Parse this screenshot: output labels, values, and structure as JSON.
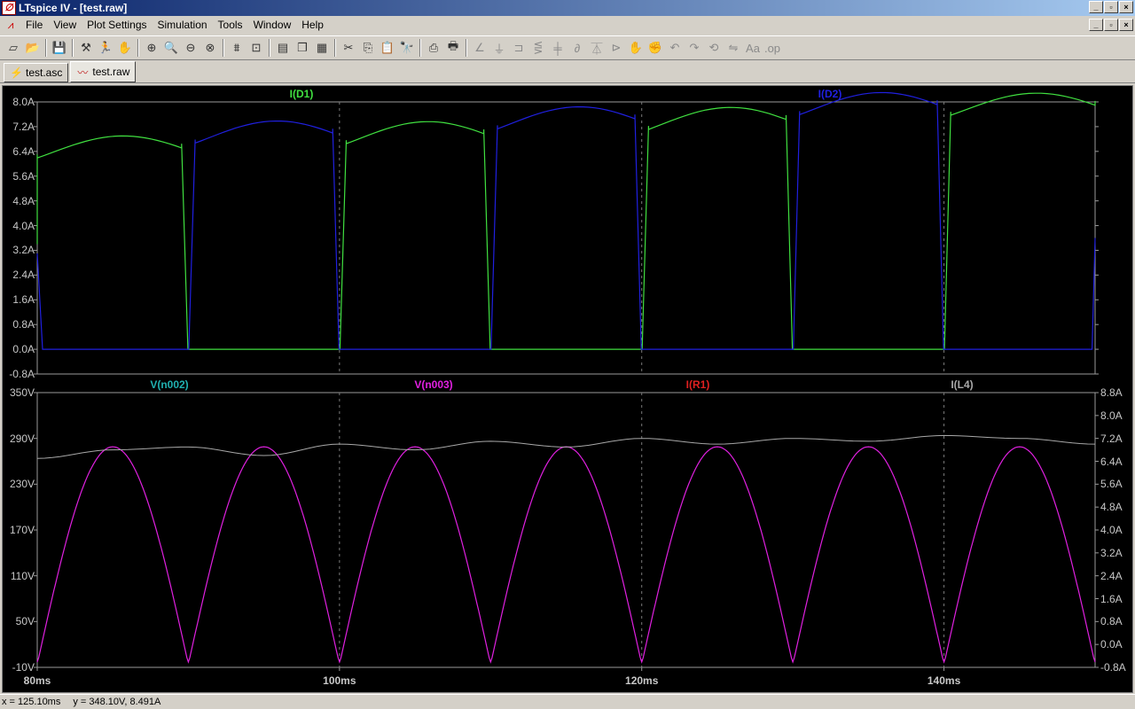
{
  "window": {
    "title": "LTspice IV - [test.raw]",
    "app_icon": "ltspice-app-icon",
    "controls": [
      "_",
      "▫",
      "x"
    ]
  },
  "menubar": {
    "icon": "waveform-doc-icon",
    "items": [
      "File",
      "View",
      "Plot Settings",
      "Simulation",
      "Tools",
      "Window",
      "Help"
    ]
  },
  "toolbar": {
    "buttons": [
      {
        "name": "new-schematic-icon",
        "glyph": "▱"
      },
      {
        "name": "open-icon",
        "glyph": "📂"
      },
      {
        "sep": true
      },
      {
        "name": "save-icon",
        "glyph": "💾"
      },
      {
        "sep": true
      },
      {
        "name": "control-panel-icon",
        "glyph": "⚒"
      },
      {
        "name": "run-icon",
        "glyph": "🏃"
      },
      {
        "name": "pan-icon",
        "glyph": "✋"
      },
      {
        "sep": true
      },
      {
        "name": "zoom-area-icon",
        "glyph": "⊕"
      },
      {
        "name": "zoom-in-icon",
        "glyph": "🔍"
      },
      {
        "name": "zoom-out-icon",
        "glyph": "⊖"
      },
      {
        "name": "zoom-cancel-icon",
        "glyph": "⊗"
      },
      {
        "sep": true
      },
      {
        "name": "autorange-icon",
        "glyph": "⩩"
      },
      {
        "name": "fit-icon",
        "glyph": "⊡"
      },
      {
        "sep": true
      },
      {
        "name": "tile-horizontal-icon",
        "glyph": "▤"
      },
      {
        "name": "cascade-icon",
        "glyph": "❐"
      },
      {
        "name": "tile-vertical-icon",
        "glyph": "▦"
      },
      {
        "sep": true
      },
      {
        "name": "cut-icon",
        "glyph": "✂"
      },
      {
        "name": "copy-icon",
        "glyph": "⎘"
      },
      {
        "name": "paste-icon",
        "glyph": "📋"
      },
      {
        "name": "find-icon",
        "glyph": "🔭"
      },
      {
        "sep": true
      },
      {
        "name": "print-preview-icon",
        "glyph": "⎙"
      },
      {
        "name": "print-icon",
        "glyph": "🖶"
      },
      {
        "sep": true
      },
      {
        "name": "wire-icon",
        "glyph": "∠",
        "dim": true
      },
      {
        "name": "ground-icon",
        "glyph": "⏚",
        "dim": true
      },
      {
        "name": "label-net-icon",
        "glyph": "⊐",
        "dim": true
      },
      {
        "name": "resistor-icon",
        "glyph": "⋚",
        "dim": true
      },
      {
        "name": "capacitor-icon",
        "glyph": "╪",
        "dim": true
      },
      {
        "name": "inductor-icon",
        "glyph": "∂",
        "dim": true
      },
      {
        "name": "diode-icon",
        "glyph": "⏄",
        "dim": true
      },
      {
        "name": "component-icon",
        "glyph": "⊳",
        "dim": true
      },
      {
        "name": "move-icon",
        "glyph": "✋",
        "dim": true
      },
      {
        "name": "drag-icon",
        "glyph": "✊",
        "dim": true
      },
      {
        "name": "undo-icon",
        "glyph": "↶",
        "dim": true
      },
      {
        "name": "redo-icon",
        "glyph": "↷",
        "dim": true
      },
      {
        "name": "rotate-icon",
        "glyph": "⟲",
        "dim": true
      },
      {
        "name": "mirror-icon",
        "glyph": "⇋",
        "dim": true
      },
      {
        "name": "text-icon",
        "glyph": "Aa",
        "dim": true
      },
      {
        "name": "spice-directive-icon",
        "glyph": ".op",
        "dim": true
      }
    ]
  },
  "tabs": [
    {
      "label": "test.asc",
      "icon": "schematic-icon",
      "glyph": "⚡",
      "active": false
    },
    {
      "label": "test.raw",
      "icon": "waveform-icon",
      "glyph": "〰",
      "active": true
    }
  ],
  "plots": {
    "top": {
      "traces": [
        {
          "label": "I(D1)",
          "color": "#40e040"
        },
        {
          "label": "I(D2)",
          "color": "#2020e0"
        }
      ],
      "y_ticks": [
        "8.0A",
        "7.2A",
        "6.4A",
        "5.6A",
        "4.8A",
        "4.0A",
        "3.2A",
        "2.4A",
        "1.6A",
        "0.8A",
        "0.0A",
        "-0.8A"
      ]
    },
    "bottom": {
      "traces": [
        {
          "label": "V(n002)",
          "color": "#20b0b0"
        },
        {
          "label": "V(n003)",
          "color": "#e020e0"
        },
        {
          "label": "I(R1)",
          "color": "#e02020"
        },
        {
          "label": "I(L4)",
          "color": "#a8a8a8"
        }
      ],
      "y_ticks_left": [
        "350V",
        "290V",
        "230V",
        "170V",
        "110V",
        "50V",
        "-10V"
      ],
      "y_ticks_right": [
        "8.8A",
        "8.0A",
        "7.2A",
        "6.4A",
        "5.6A",
        "4.8A",
        "4.0A",
        "3.2A",
        "2.4A",
        "1.6A",
        "0.8A",
        "0.0A",
        "-0.8A"
      ]
    },
    "x_ticks": [
      "80ms",
      "100ms",
      "120ms",
      "140ms"
    ]
  },
  "chart_data": [
    {
      "type": "line",
      "title": "",
      "xlabel": "",
      "ylabel": "",
      "xlim_ms": [
        80,
        150
      ],
      "ylim": [
        -0.8,
        8.0
      ],
      "y_unit": "A",
      "series": [
        {
          "name": "I(D1)",
          "color": "#40e040",
          "conducting_windows_ms": [
            [
              80.0,
              89.9
            ],
            [
              100.1,
              109.9
            ],
            [
              120.1,
              129.9
            ],
            [
              140.1,
              150.0
            ]
          ],
          "x_ms": [
            80.1,
            80.5,
            82.0,
            84.0,
            86.0,
            88.0,
            89.7
          ],
          "values_A": [
            6.4,
            6.5,
            6.4,
            6.6,
            6.8,
            6.9,
            6.9
          ]
        },
        {
          "name": "I(D2)",
          "color": "#2020e0",
          "conducting_windows_ms": [
            [
              90.1,
              99.9
            ],
            [
              110.1,
              119.9
            ],
            [
              130.1,
              139.9
            ]
          ],
          "x_ms": [
            90.2,
            92.0,
            94.0,
            96.0,
            98.0,
            99.7
          ],
          "values_A": [
            6.7,
            6.6,
            6.8,
            7.0,
            7.1,
            7.0
          ]
        }
      ]
    },
    {
      "type": "line",
      "title": "",
      "xlabel": "",
      "ylabel": "",
      "xlim_ms": [
        80,
        150
      ],
      "ylim_left": [
        -10,
        350
      ],
      "ylim_right": [
        -0.8,
        8.8
      ],
      "series": [
        {
          "name": "V(n003)",
          "color": "#e020e0",
          "description_points": "full-wave rectified sine, 10ms period, peak ~285V, clamped ~-3V near zero crossings",
          "peak_V": 285,
          "min_V": -3,
          "period_ms": 10,
          "zero_crossings_ms": [
            80,
            90,
            100,
            110,
            120,
            130,
            140,
            150
          ]
        },
        {
          "name": "I(L4)",
          "color": "#a8a8a8",
          "axis": "right",
          "x_ms": [
            80,
            85,
            90,
            95,
            100,
            105,
            110,
            115,
            120,
            125,
            130,
            135,
            140,
            145,
            150
          ],
          "values_A": [
            6.5,
            6.8,
            6.9,
            6.6,
            7.0,
            6.8,
            7.1,
            6.9,
            7.2,
            7.0,
            7.2,
            7.1,
            7.3,
            7.2,
            7.0
          ]
        }
      ]
    }
  ],
  "statusbar": {
    "x_readout": "x = 125.10ms",
    "y_readout": "y = 348.10V, 8.491A"
  }
}
